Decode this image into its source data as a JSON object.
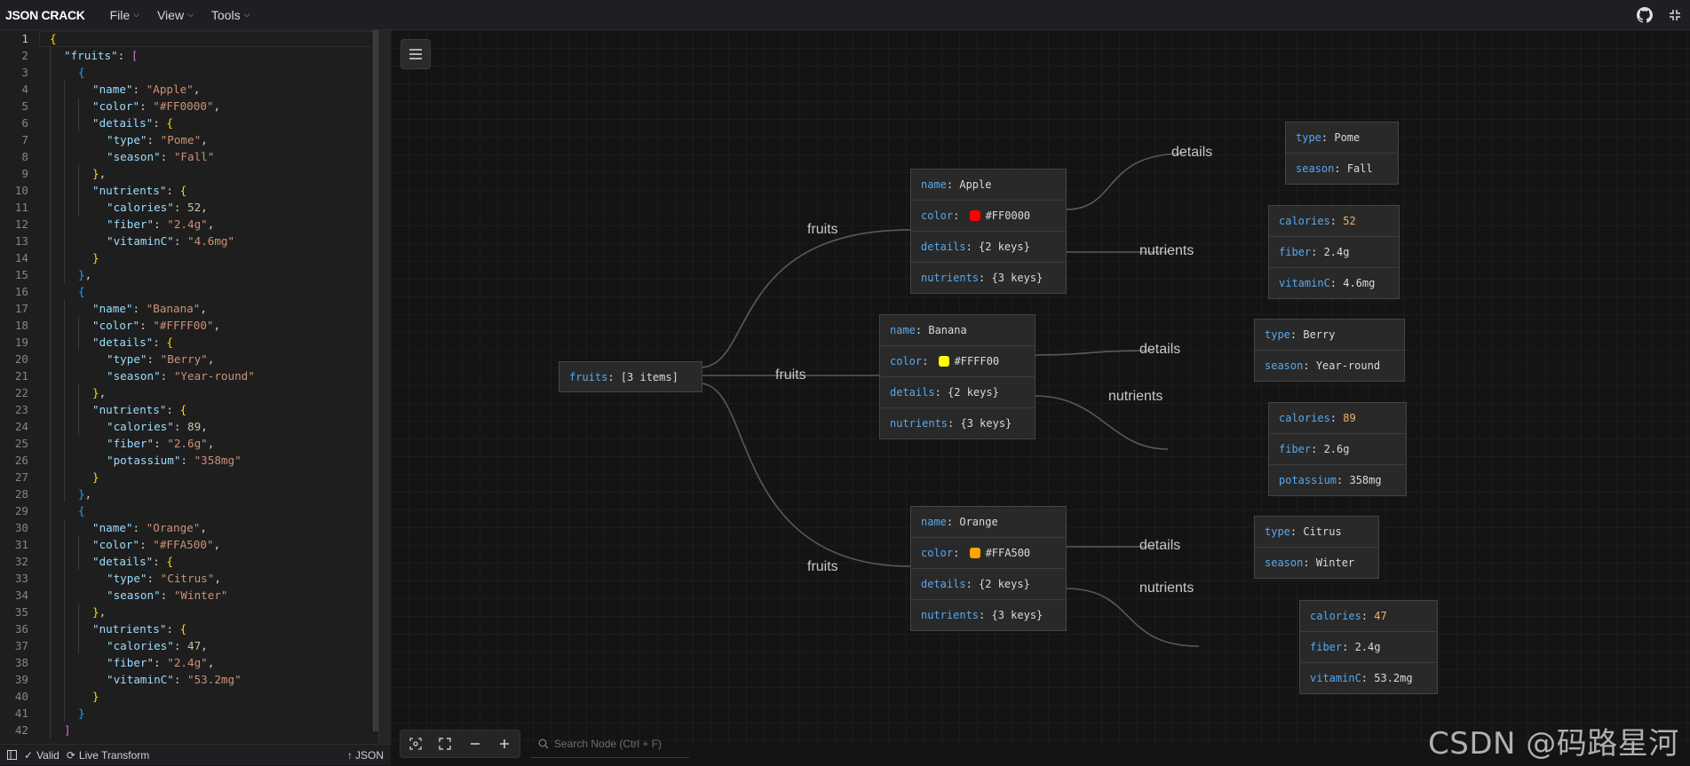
{
  "app": {
    "logo": "JSON CRACK",
    "menus": [
      {
        "label": "File"
      },
      {
        "label": "View"
      },
      {
        "label": "Tools"
      }
    ]
  },
  "editor": {
    "line_numbers": [
      "1",
      "2",
      "3",
      "4",
      "5",
      "6",
      "7",
      "8",
      "9",
      "10",
      "11",
      "12",
      "13",
      "14",
      "15",
      "16",
      "17",
      "18",
      "19",
      "20",
      "21",
      "22",
      "23",
      "24",
      "25",
      "26",
      "27",
      "28",
      "29",
      "30",
      "31",
      "32",
      "33",
      "34",
      "35",
      "36",
      "37",
      "38",
      "39",
      "40",
      "41",
      "42"
    ],
    "tokens": {
      "l1": "{",
      "l2_key": "\"fruits\"",
      "l2_colon": ": ",
      "l2_br": "[",
      "l3": "{",
      "l4_key": "\"name\"",
      "l4_val": "\"Apple\"",
      "l5_key": "\"color\"",
      "l5_val": "\"#FF0000\"",
      "l6_key": "\"details\"",
      "l6_br": "{",
      "l7_key": "\"type\"",
      "l7_val": "\"Pome\"",
      "l8_key": "\"season\"",
      "l8_val": "\"Fall\"",
      "l9": "}",
      "l10_key": "\"nutrients\"",
      "l10_br": "{",
      "l11_key": "\"calories\"",
      "l11_val": "52",
      "l12_key": "\"fiber\"",
      "l12_val": "\"2.4g\"",
      "l13_key": "\"vitaminC\"",
      "l13_val": "\"4.6mg\"",
      "l14": "}",
      "l15": "}",
      "l16": "{",
      "l17_key": "\"name\"",
      "l17_val": "\"Banana\"",
      "l18_key": "\"color\"",
      "l18_val": "\"#FFFF00\"",
      "l19_key": "\"details\"",
      "l19_br": "{",
      "l20_key": "\"type\"",
      "l20_val": "\"Berry\"",
      "l21_key": "\"season\"",
      "l21_val": "\"Year-round\"",
      "l22": "}",
      "l23_key": "\"nutrients\"",
      "l23_br": "{",
      "l24_key": "\"calories\"",
      "l24_val": "89",
      "l25_key": "\"fiber\"",
      "l25_val": "\"2.6g\"",
      "l26_key": "\"potassium\"",
      "l26_val": "\"358mg\"",
      "l27": "}",
      "l28": "}",
      "l29": "{",
      "l30_key": "\"name\"",
      "l30_val": "\"Orange\"",
      "l31_key": "\"color\"",
      "l31_val": "\"#FFA500\"",
      "l32_key": "\"details\"",
      "l32_br": "{",
      "l33_key": "\"type\"",
      "l33_val": "\"Citrus\"",
      "l34_key": "\"season\"",
      "l34_val": "\"Winter\"",
      "l35": "}",
      "l36_key": "\"nutrients\"",
      "l36_br": "{",
      "l37_key": "\"calories\"",
      "l37_val": "47",
      "l38_key": "\"fiber\"",
      "l38_val": "\"2.4g\"",
      "l39_key": "\"vitaminC\"",
      "l39_val": "\"53.2mg\"",
      "l40": "}",
      "l41": "}",
      "l42": "]"
    }
  },
  "graph": {
    "root": {
      "key": "fruits",
      "value": "[3 items]"
    },
    "edge_labels": {
      "fruits": "fruits",
      "details": "details",
      "nutrients": "nutrients"
    },
    "apple": {
      "name_key": "name",
      "name": "Apple",
      "color_key": "color",
      "color": "#FF0000",
      "details_key": "details",
      "details": "{2 keys}",
      "nutrients_key": "nutrients",
      "nutrients": "{3 keys}",
      "type_key": "type",
      "type": "Pome",
      "season_key": "season",
      "season": "Fall",
      "calories_key": "calories",
      "calories": "52",
      "fiber_key": "fiber",
      "fiber": "2.4g",
      "extra_key": "vitaminC",
      "extra": "4.6mg"
    },
    "banana": {
      "name_key": "name",
      "name": "Banana",
      "color_key": "color",
      "color": "#FFFF00",
      "details_key": "details",
      "details": "{2 keys}",
      "nutrients_key": "nutrients",
      "nutrients": "{3 keys}",
      "type_key": "type",
      "type": "Berry",
      "season_key": "season",
      "season": "Year-round",
      "calories_key": "calories",
      "calories": "89",
      "fiber_key": "fiber",
      "fiber": "2.6g",
      "extra_key": "potassium",
      "extra": "358mg"
    },
    "orange": {
      "name_key": "name",
      "name": "Orange",
      "color_key": "color",
      "color": "#FFA500",
      "details_key": "details",
      "details": "{2 keys}",
      "nutrients_key": "nutrients",
      "nutrients": "{3 keys}",
      "type_key": "type",
      "type": "Citrus",
      "season_key": "season",
      "season": "Winter",
      "calories_key": "calories",
      "calories": "47",
      "fiber_key": "fiber",
      "fiber": "2.4g",
      "extra_key": "vitaminC",
      "extra": "53.2mg"
    }
  },
  "search": {
    "placeholder": "Search Node (Ctrl + F)"
  },
  "status": {
    "valid": "Valid",
    "live_transform": "Live Transform",
    "format": "JSON"
  },
  "watermark": "CSDN @码路星河",
  "colors": {
    "accent_key": "#56a8ef",
    "number": "#e8b762",
    "canvas_bg": "#141414",
    "apple_swatch": "#FF0000",
    "banana_swatch": "#FFFF00",
    "orange_swatch": "#FFA500"
  },
  "icons": [
    "chevron-down-icon",
    "github-icon",
    "fullscreen-exit-icon",
    "hamburger-icon",
    "focus-icon",
    "expand-icon",
    "zoom-out-icon",
    "zoom-in-icon",
    "search-icon",
    "check-icon",
    "transform-icon",
    "upload-icon"
  ]
}
